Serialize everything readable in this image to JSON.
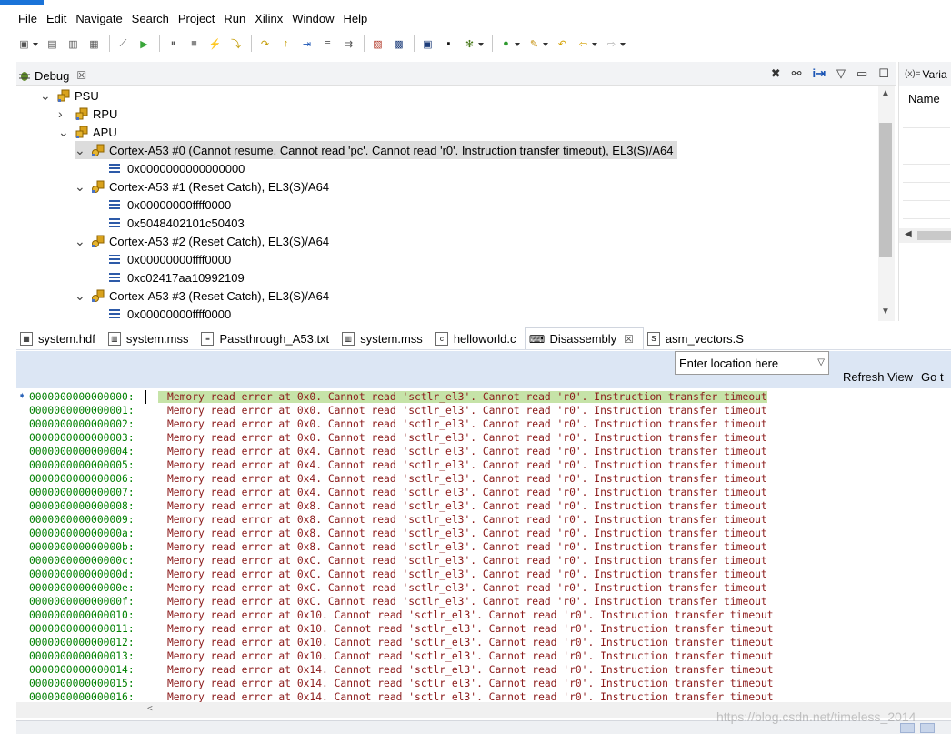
{
  "menu": [
    "File",
    "Edit",
    "Navigate",
    "Search",
    "Project",
    "Run",
    "Xilinx",
    "Window",
    "Help"
  ],
  "toolbar_icons": [
    "new-icon",
    "save-icon",
    "save-all-icon",
    "build-icon",
    "skip-breakpoints-icon",
    "resume-icon",
    "suspend-icon",
    "terminate-icon",
    "disconnect-icon",
    "step-into-icon",
    "step-over-icon",
    "step-return-icon",
    "instruction-stepping-icon",
    "use-step-filters-icon",
    "drop-to-frame-icon",
    "program-fpga-icon",
    "sdk-terminal-icon",
    "xsct-console-icon",
    "xmd-console-icon",
    "debug-icon",
    "run-icon",
    "external-tools-icon",
    "last-edit-icon",
    "back-icon",
    "forward-icon"
  ],
  "debug_view": {
    "tab_label": "Debug",
    "tree": [
      {
        "depth": 1,
        "expanded": true,
        "kind": "target",
        "label": "PSU"
      },
      {
        "depth": 2,
        "expanded": false,
        "kind": "target",
        "label": "RPU"
      },
      {
        "depth": 2,
        "expanded": true,
        "kind": "target",
        "label": "APU"
      },
      {
        "depth": 3,
        "expanded": true,
        "kind": "core",
        "label": "Cortex-A53 #0 (Cannot resume. Cannot read 'pc'. Cannot read 'r0'. Instruction transfer timeout), EL3(S)/A64",
        "selected": true
      },
      {
        "depth": 4,
        "kind": "frame",
        "label": "0x0000000000000000"
      },
      {
        "depth": 3,
        "expanded": true,
        "kind": "core",
        "label": "Cortex-A53 #1 (Reset Catch), EL3(S)/A64"
      },
      {
        "depth": 4,
        "kind": "frame",
        "label": "0x00000000ffff0000"
      },
      {
        "depth": 4,
        "kind": "frame",
        "label": "0x5048402101c50403"
      },
      {
        "depth": 3,
        "expanded": true,
        "kind": "core",
        "label": "Cortex-A53 #2 (Reset Catch), EL3(S)/A64"
      },
      {
        "depth": 4,
        "kind": "frame",
        "label": "0x00000000ffff0000"
      },
      {
        "depth": 4,
        "kind": "frame",
        "label": "0xc02417aa10992109"
      },
      {
        "depth": 3,
        "expanded": true,
        "kind": "core",
        "label": "Cortex-A53 #3 (Reset Catch), EL3(S)/A64"
      },
      {
        "depth": 4,
        "kind": "frame",
        "label": "0x00000000ffff0000"
      }
    ]
  },
  "variables_view": {
    "tab_label": "Varia",
    "tab_prefix": "(x)=",
    "column_header": "Name"
  },
  "editor_tabs": [
    {
      "label": "system.hdf",
      "icon": "hdf-file-icon",
      "active": false
    },
    {
      "label": "system.mss",
      "icon": "mss-file-icon",
      "active": false
    },
    {
      "label": "Passthrough_A53.txt",
      "icon": "text-file-icon",
      "active": false
    },
    {
      "label": "system.mss",
      "icon": "mss-file-icon",
      "active": false
    },
    {
      "label": "helloworld.c",
      "icon": "c-file-icon",
      "active": false
    },
    {
      "label": "Disassembly",
      "icon": "disassembly-icon",
      "active": true
    },
    {
      "label": "asm_vectors.S",
      "icon": "asm-file-icon",
      "active": false
    }
  ],
  "disassembly": {
    "location_placeholder": "Enter location here",
    "refresh_label": "Refresh View",
    "goto_label": "Go t",
    "rows": [
      {
        "addr": "0000000000000000:",
        "msg": "Memory read error at 0x0. Cannot read 'sctlr_el3'. Cannot read 'r0'. Instruction transfer timeout"
      },
      {
        "addr": "0000000000000001:",
        "msg": "Memory read error at 0x0. Cannot read 'sctlr_el3'. Cannot read 'r0'. Instruction transfer timeout"
      },
      {
        "addr": "0000000000000002:",
        "msg": "Memory read error at 0x0. Cannot read 'sctlr_el3'. Cannot read 'r0'. Instruction transfer timeout"
      },
      {
        "addr": "0000000000000003:",
        "msg": "Memory read error at 0x0. Cannot read 'sctlr_el3'. Cannot read 'r0'. Instruction transfer timeout"
      },
      {
        "addr": "0000000000000004:",
        "msg": "Memory read error at 0x4. Cannot read 'sctlr_el3'. Cannot read 'r0'. Instruction transfer timeout"
      },
      {
        "addr": "0000000000000005:",
        "msg": "Memory read error at 0x4. Cannot read 'sctlr_el3'. Cannot read 'r0'. Instruction transfer timeout"
      },
      {
        "addr": "0000000000000006:",
        "msg": "Memory read error at 0x4. Cannot read 'sctlr_el3'. Cannot read 'r0'. Instruction transfer timeout"
      },
      {
        "addr": "0000000000000007:",
        "msg": "Memory read error at 0x4. Cannot read 'sctlr_el3'. Cannot read 'r0'. Instruction transfer timeout"
      },
      {
        "addr": "0000000000000008:",
        "msg": "Memory read error at 0x8. Cannot read 'sctlr_el3'. Cannot read 'r0'. Instruction transfer timeout"
      },
      {
        "addr": "0000000000000009:",
        "msg": "Memory read error at 0x8. Cannot read 'sctlr_el3'. Cannot read 'r0'. Instruction transfer timeout"
      },
      {
        "addr": "000000000000000a:",
        "msg": "Memory read error at 0x8. Cannot read 'sctlr_el3'. Cannot read 'r0'. Instruction transfer timeout"
      },
      {
        "addr": "000000000000000b:",
        "msg": "Memory read error at 0x8. Cannot read 'sctlr_el3'. Cannot read 'r0'. Instruction transfer timeout"
      },
      {
        "addr": "000000000000000c:",
        "msg": "Memory read error at 0xC. Cannot read 'sctlr_el3'. Cannot read 'r0'. Instruction transfer timeout"
      },
      {
        "addr": "000000000000000d:",
        "msg": "Memory read error at 0xC. Cannot read 'sctlr_el3'. Cannot read 'r0'. Instruction transfer timeout"
      },
      {
        "addr": "000000000000000e:",
        "msg": "Memory read error at 0xC. Cannot read 'sctlr_el3'. Cannot read 'r0'. Instruction transfer timeout"
      },
      {
        "addr": "000000000000000f:",
        "msg": "Memory read error at 0xC. Cannot read 'sctlr_el3'. Cannot read 'r0'. Instruction transfer timeout"
      },
      {
        "addr": "0000000000000010:",
        "msg": "Memory read error at 0x10. Cannot read 'sctlr_el3'. Cannot read 'r0'. Instruction transfer timeout"
      },
      {
        "addr": "0000000000000011:",
        "msg": "Memory read error at 0x10. Cannot read 'sctlr_el3'. Cannot read 'r0'. Instruction transfer timeout"
      },
      {
        "addr": "0000000000000012:",
        "msg": "Memory read error at 0x10. Cannot read 'sctlr_el3'. Cannot read 'r0'. Instruction transfer timeout"
      },
      {
        "addr": "0000000000000013:",
        "msg": "Memory read error at 0x10. Cannot read 'sctlr_el3'. Cannot read 'r0'. Instruction transfer timeout"
      },
      {
        "addr": "0000000000000014:",
        "msg": "Memory read error at 0x14. Cannot read 'sctlr_el3'. Cannot read 'r0'. Instruction transfer timeout"
      },
      {
        "addr": "0000000000000015:",
        "msg": "Memory read error at 0x14. Cannot read 'sctlr_el3'. Cannot read 'r0'. Instruction transfer timeout"
      },
      {
        "addr": "0000000000000016:",
        "msg": "Memory read error at 0x14. Cannot read 'sctlr_el3'. Cannot read 'r0'. Instruction transfer timeout"
      }
    ]
  },
  "watermark": "https://blog.csdn.net/timeless_2014",
  "colors": {
    "address_green": "#008000",
    "error_text": "#8b1a1a",
    "current_line_highlight": "#c6e3a8",
    "disassembly_toolbar_bg": "#dce6f4",
    "accent": "#1a73d8"
  }
}
